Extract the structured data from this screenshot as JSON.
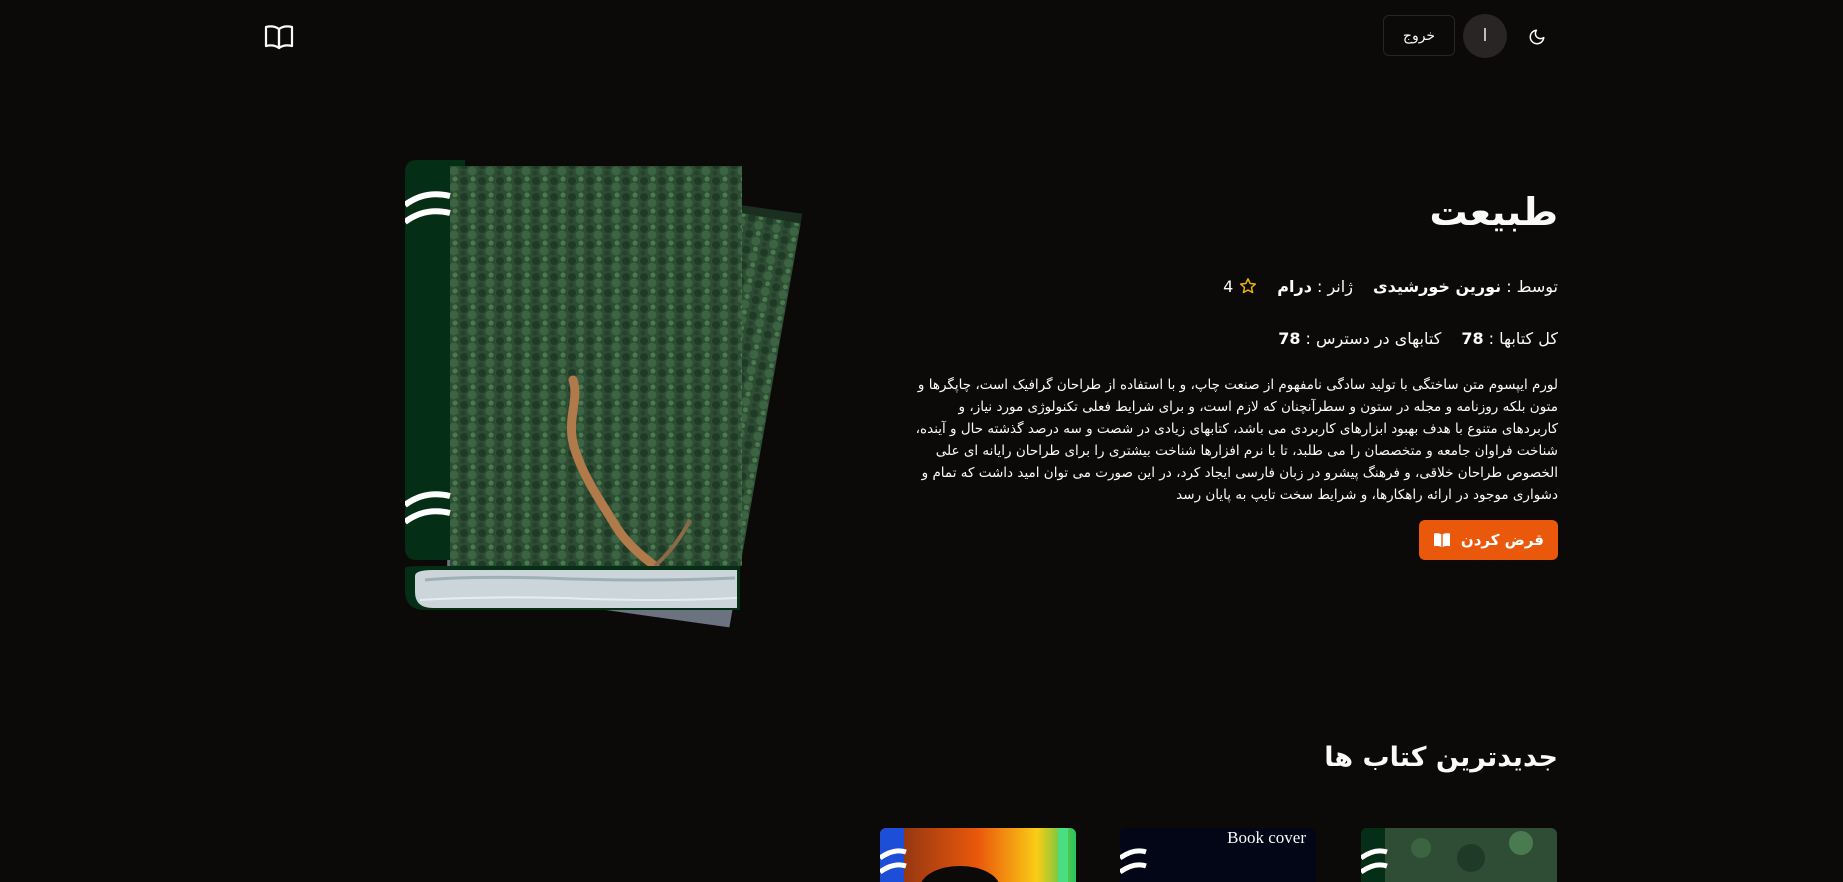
{
  "header": {
    "logout_label": "خروج",
    "avatar_initial": "ا",
    "theme_icon": "moon-icon",
    "logo_icon": "open-book-icon"
  },
  "book": {
    "title": "طبیعت",
    "author_label": "توسط :",
    "author": "نورین خورشیدی",
    "genre_label": "ژانر :",
    "genre": "درام",
    "rating": "4",
    "total_label": "کل کتابها :",
    "total": "78",
    "available_label": "کتابهای در دسترس :",
    "available": "78",
    "description": "لورم ایپسوم متن ساختگی با تولید سادگی نامفهوم از صنعت چاپ، و با استفاده از طراحان گرافیک است، چاپگرها و متون بلکه روزنامه و مجله در ستون و سطرآنچنان که لازم است، و برای شرایط فعلی تکنولوژی مورد نیاز، و کاربردهای متنوع با هدف بهبود ابزارهای کاربردی می باشد، کتابهای زیادی در شصت و سه درصد گذشته حال و آینده، شناخت فراوان جامعه و متخصصان را می طلبد، تا با نرم افزارها شناخت بیشتری را برای طراحان رایانه ای علی الخصوص طراحان خلاقی، و فرهنگ پیشرو در زبان فارسی ایجاد کرد، در این صورت می توان امید داشت که تمام و دشواری موجود در ارائه راهکارها، و شرایط سخت تایپ به پایان رسد",
    "borrow_label": "قرض کردن"
  },
  "latest": {
    "title": "جدیدترین کتاب ها",
    "broken_cover_alt": "Book cover"
  },
  "colors": {
    "background": "#0c0a09",
    "accent": "#ea580c",
    "star": "#eab308",
    "spine": "#052e16"
  }
}
